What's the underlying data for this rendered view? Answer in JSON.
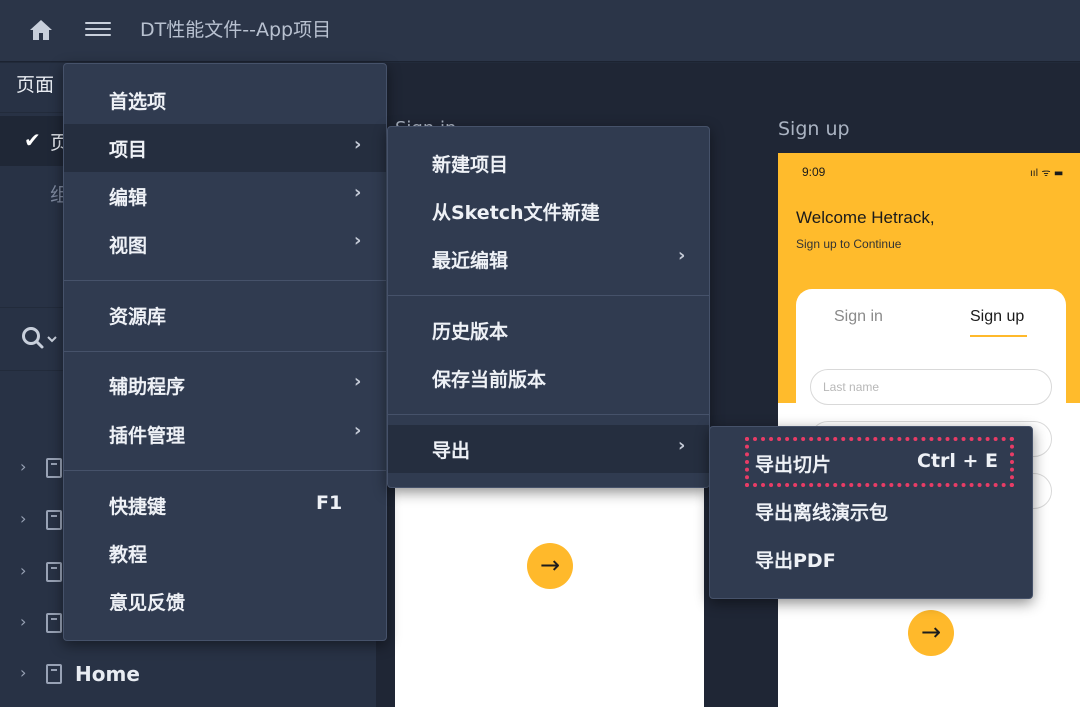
{
  "topbar": {
    "title": "DT性能文件--App项目",
    "home_icon": "home-icon",
    "menu_icon": "hamburger-menu-icon"
  },
  "left_panel": {
    "pages_label": "页面",
    "selected_page_text": "页",
    "sub_page_text": "组",
    "layers": [
      {
        "name": ""
      },
      {
        "name": ""
      },
      {
        "name": ""
      },
      {
        "name": ""
      },
      {
        "name": "Home"
      }
    ]
  },
  "canvas": {
    "artboard_1_label": "Sign in",
    "artboard_2_label": "Sign up",
    "arrow_glyph": "→",
    "artboard_2": {
      "time": "9:09",
      "status": "ııl ᯤ ▬",
      "welcome": "Welcome Hetrack,",
      "subtitle": "Sign up to Continue",
      "tab_sign_in": "Sign in",
      "tab_sign_up": "Sign up",
      "last_name_placeholder": "Last name"
    }
  },
  "main_menu": {
    "items": [
      {
        "label": "首选项"
      },
      {
        "label": "项目",
        "submenu": true
      },
      {
        "label": "编辑",
        "submenu": true
      },
      {
        "label": "视图",
        "submenu": true
      },
      {
        "label": "资源库"
      },
      {
        "label": "辅助程序",
        "submenu": true
      },
      {
        "label": "插件管理",
        "submenu": true
      },
      {
        "label": "快捷键",
        "shortcut": "F1"
      },
      {
        "label": "教程"
      },
      {
        "label": "意见反馈"
      }
    ]
  },
  "project_menu": {
    "items": [
      {
        "label": "新建项目"
      },
      {
        "label": "从Sketch文件新建"
      },
      {
        "label": "最近编辑",
        "submenu": true
      },
      {
        "label": "历史版本"
      },
      {
        "label": "保存当前版本"
      },
      {
        "label": "导出",
        "submenu": true
      }
    ]
  },
  "export_menu": {
    "items": [
      {
        "label": "导出切片",
        "shortcut": "Ctrl + E"
      },
      {
        "label": "导出离线演示包"
      },
      {
        "label": "导出PDF"
      }
    ]
  },
  "colors": {
    "accent_yellow": "#ffb92b",
    "highlight_red": "#e83c66",
    "menu_bg": "#303b50"
  }
}
